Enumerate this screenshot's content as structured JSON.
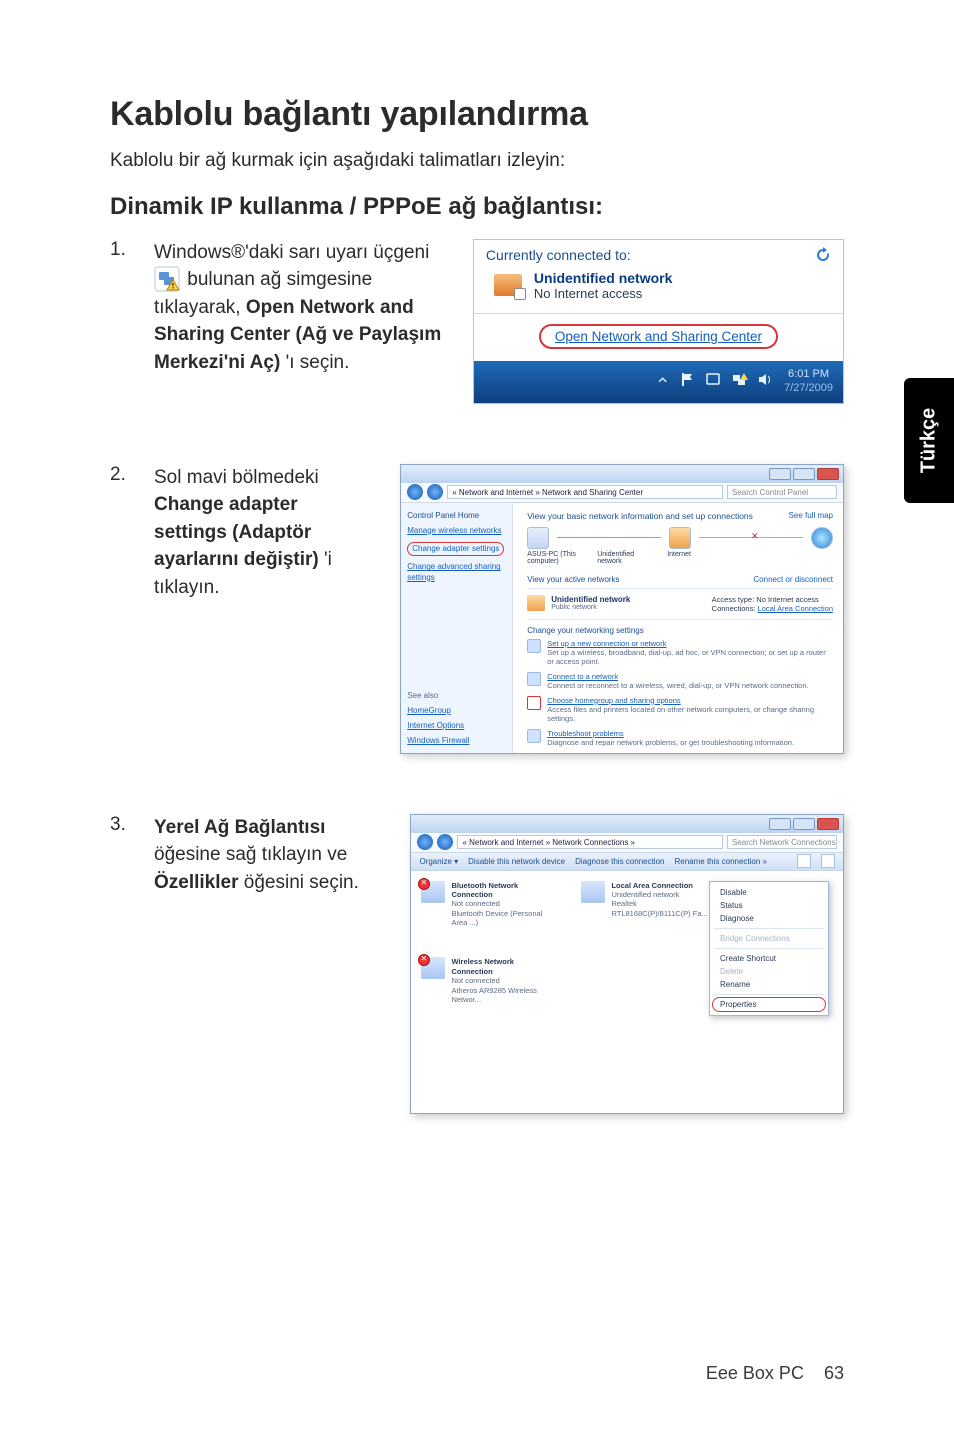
{
  "side_tab": "Türkçe",
  "title": "Kablolu bağlantı yapılandırma",
  "intro": "Kablolu bir ağ kurmak için aşağıdaki talimatları izleyin:",
  "subtitle": "Dinamik IP kullanma / PPPoE ağ bağlantısı:",
  "steps": {
    "s1": {
      "num": "1.",
      "text_before_icon": "Windows®'daki sarı uyarı üçgeni ",
      "text_after_icon": " bulunan ağ simgesine tıklayarak, ",
      "bold1": "Open Network and Sharing Center (Ağ ve Paylaşım Merkezi'ni Aç)",
      "text_tail": "'ı seçin."
    },
    "s2": {
      "num": "2.",
      "text_a": "Sol mavi bölmedeki ",
      "bold": "Change adapter settings (Adaptör ayarlarını değiştir)",
      "text_b": "'i tıklayın."
    },
    "s3": {
      "num": "3.",
      "bold1": "Yerel Ağ Bağlantısı",
      "mid": " öğesine sağ tıklayın ve ",
      "bold2": "Özellikler",
      "tail": " öğesini seçin."
    }
  },
  "fig1": {
    "header": "Currently connected to:",
    "net_title": "Unidentified network",
    "net_sub": "No Internet access",
    "link": "Open Network and Sharing Center",
    "time": "6:01 PM",
    "date": "7/27/2009"
  },
  "fig2": {
    "breadcrumb": "« Network and Internet » Network and Sharing Center",
    "search_placeholder": "Search Control Panel",
    "left": {
      "head": "Control Panel Home",
      "links": [
        "Manage wireless networks",
        "Change adapter settings",
        "Change advanced sharing settings"
      ],
      "seealso_label": "See also",
      "seealso": [
        "HomeGroup",
        "Internet Options",
        "Windows Firewall"
      ]
    },
    "main": {
      "title": "View your basic network information and set up connections",
      "fullmap": "See full map",
      "map_captions": [
        "ASUS-PC (This computer)",
        "Unidentified network",
        "Internet"
      ],
      "active_head": "View your active networks",
      "active_connect": "Connect or disconnect",
      "active_name": "Unidentified network",
      "active_type": "Public network",
      "active_right_access": "Access type:",
      "active_right_access_v": "No Internet access",
      "active_right_conn": "Connections:",
      "active_right_conn_v": "Local Area Connection",
      "change_head": "Change your networking settings",
      "tasks": [
        {
          "h": "Set up a new connection or network",
          "d": "Set up a wireless, broadband, dial-up, ad hoc, or VPN connection; or set up a router or access point."
        },
        {
          "h": "Connect to a network",
          "d": "Connect or reconnect to a wireless, wired, dial-up, or VPN network connection."
        },
        {
          "h": "Choose homegroup and sharing options",
          "d": "Access files and printers located on other network computers, or change sharing settings."
        },
        {
          "h": "Troubleshoot problems",
          "d": "Diagnose and repair network problems, or get troubleshooting information."
        }
      ]
    }
  },
  "fig3": {
    "breadcrumb": "« Network and Internet » Network Connections »",
    "search_placeholder": "Search Network Connections",
    "toolbar": {
      "organize": "Organize ▾",
      "disable": "Disable this network device",
      "diagnose": "Diagnose this connection",
      "rename": "Rename this connection »"
    },
    "connections": [
      {
        "name": "Bluetooth Network Connection",
        "status": "Not connected",
        "dev": "Bluetooth Device (Personal Area ...)",
        "dis": true
      },
      {
        "name": "Local Area Connection",
        "status": "Unidentified network",
        "dev": "Realtek RTL8168C(P)/8111C(P) Fa...",
        "dis": false
      },
      {
        "name": "Wireless Network Connection",
        "status": "Not connected",
        "dev": "Atheros AR9285 Wireless Networ...",
        "dis": true
      }
    ],
    "context_menu": [
      {
        "label": "Disable",
        "enabled": true
      },
      {
        "label": "Status",
        "enabled": true
      },
      {
        "label": "Diagnose",
        "enabled": true
      },
      {
        "sep": true
      },
      {
        "label": "Bridge Connections",
        "enabled": false
      },
      {
        "sep": true
      },
      {
        "label": "Create Shortcut",
        "enabled": true
      },
      {
        "label": "Delete",
        "enabled": false
      },
      {
        "label": "Rename",
        "enabled": true
      },
      {
        "sep": true
      },
      {
        "label": "Properties",
        "enabled": true,
        "selected": true
      }
    ]
  },
  "footer": {
    "product": "Eee Box PC",
    "page": "63"
  }
}
